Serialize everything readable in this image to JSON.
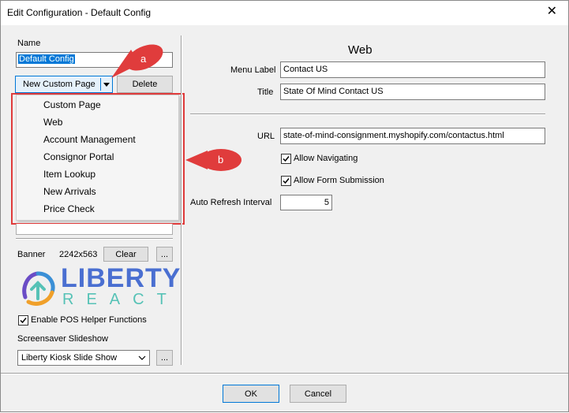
{
  "window": {
    "title": "Edit Configuration - Default Config",
    "close_glyph": "✕"
  },
  "left": {
    "name_label": "Name",
    "name_value": "Default Config",
    "new_page_button": "New Custom Page",
    "delete_button": "Delete",
    "dropdown_items": [
      "Custom Page",
      "Web",
      "Account Management",
      "Consignor Portal",
      "Item Lookup",
      "New Arrivals",
      "Price Check"
    ],
    "banner_label": "Banner",
    "banner_size": "2242x563",
    "clear_button": "Clear",
    "browse_button": "...",
    "logo_top": "LIBERTY",
    "logo_bottom": "REACT",
    "pos_helper_label": "Enable POS Helper Functions",
    "pos_helper_checked": true,
    "screensaver_label": "Screensaver Slideshow",
    "screensaver_value": "Liberty Kiosk Slide Show",
    "screensaver_browse": "..."
  },
  "right": {
    "section_title": "Web",
    "menu_label_label": "Menu Label",
    "menu_label_value": "Contact US",
    "title_label": "Title",
    "title_value": "State Of Mind Contact US",
    "url_label": "URL",
    "url_value": "state-of-mind-consignment.myshopify.com/contactus.html",
    "allow_navigating_label": "Allow Navigating",
    "allow_navigating_checked": true,
    "allow_form_label": "Allow Form Submission",
    "allow_form_checked": true,
    "auto_refresh_label": "Auto Refresh Interval",
    "auto_refresh_value": "5"
  },
  "footer": {
    "ok_button": "OK",
    "cancel_button": "Cancel"
  },
  "annotations": {
    "a": "a",
    "b": "b"
  },
  "colors": {
    "accent": "#0078d7",
    "callout_red": "#e03c3c",
    "logo_blue": "#4a6fd1",
    "logo_teal": "#56c2b6"
  }
}
